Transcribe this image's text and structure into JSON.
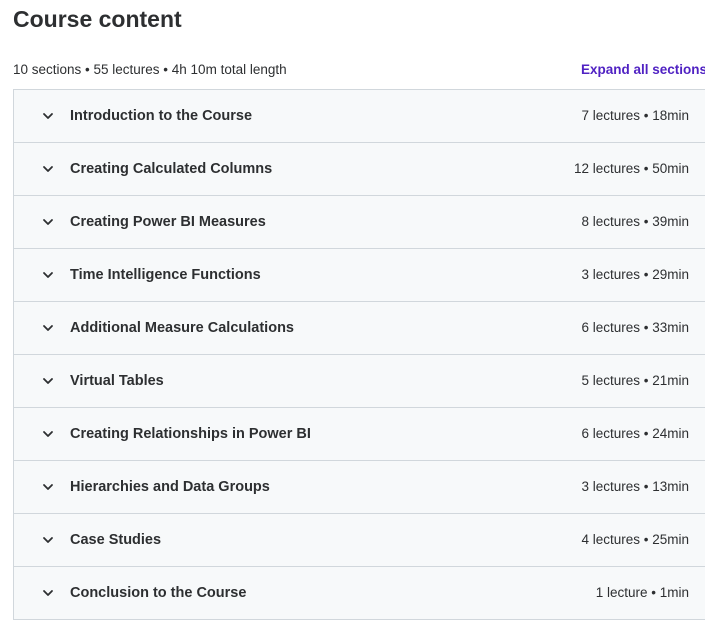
{
  "header": {
    "title": "Course content"
  },
  "summary": {
    "text": "10 sections • 55 lectures • 4h 10m total length",
    "expand_label": "Expand all sections"
  },
  "colors": {
    "accent": "#5022c3",
    "row_background": "#f7f9fa",
    "border": "#d1d7dc",
    "text": "#2d2f31"
  },
  "icons": {
    "section_toggle": "chevron-down-icon"
  },
  "sections": [
    {
      "title": "Introduction to the Course",
      "meta": "7 lectures • 18min"
    },
    {
      "title": "Creating Calculated Columns",
      "meta": "12 lectures • 50min"
    },
    {
      "title": "Creating Power BI Measures",
      "meta": "8 lectures • 39min"
    },
    {
      "title": "Time Intelligence Functions",
      "meta": "3 lectures • 29min"
    },
    {
      "title": "Additional Measure Calculations",
      "meta": "6 lectures • 33min"
    },
    {
      "title": "Virtual Tables",
      "meta": "5 lectures • 21min"
    },
    {
      "title": "Creating Relationships in Power BI",
      "meta": "6 lectures • 24min"
    },
    {
      "title": "Hierarchies and Data Groups",
      "meta": "3 lectures • 13min"
    },
    {
      "title": "Case Studies",
      "meta": "4 lectures • 25min"
    },
    {
      "title": "Conclusion to the Course",
      "meta": "1 lecture • 1min"
    }
  ]
}
